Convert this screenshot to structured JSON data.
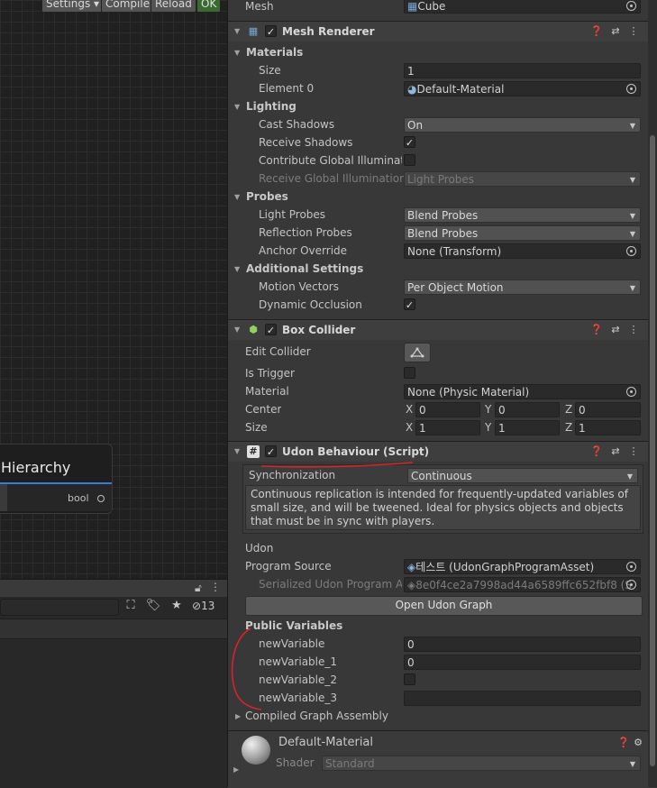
{
  "graph": {
    "top_buttons": {
      "settings": "Settings",
      "compile": "Compile",
      "reload": "Reload",
      "ok": "OK"
    },
    "node": {
      "title": "Hierarchy",
      "output_pin": "bool"
    },
    "bottom_count": "13"
  },
  "inspector": {
    "mesh_filter": {
      "mesh_label": "Mesh",
      "mesh_value": "Cube"
    },
    "mesh_renderer": {
      "title": "Mesh Renderer",
      "materials_label": "Materials",
      "size_label": "Size",
      "size_value": "1",
      "element0_label": "Element 0",
      "element0_value": "Default-Material",
      "lighting_label": "Lighting",
      "cast_shadows_label": "Cast Shadows",
      "cast_shadows_value": "On",
      "receive_shadows_label": "Receive Shadows",
      "receive_shadows_checked": true,
      "contribute_gi_label": "Contribute Global Illuminatio",
      "contribute_gi_checked": false,
      "receive_gi_label": "Receive Global Illumination",
      "receive_gi_value": "Light Probes",
      "probes_label": "Probes",
      "light_probes_label": "Light Probes",
      "light_probes_value": "Blend Probes",
      "reflection_probes_label": "Reflection Probes",
      "reflection_probes_value": "Blend Probes",
      "anchor_override_label": "Anchor Override",
      "anchor_override_value": "None (Transform)",
      "additional_label": "Additional Settings",
      "motion_vectors_label": "Motion Vectors",
      "motion_vectors_value": "Per Object Motion",
      "dynamic_occlusion_label": "Dynamic Occlusion",
      "dynamic_occlusion_checked": true
    },
    "box_collider": {
      "title": "Box Collider",
      "edit_collider_label": "Edit Collider",
      "is_trigger_label": "Is Trigger",
      "is_trigger_checked": false,
      "material_label": "Material",
      "material_value": "None (Physic Material)",
      "center_label": "Center",
      "center": {
        "x": "0",
        "y": "0",
        "z": "0"
      },
      "size_label": "Size",
      "size": {
        "x": "1",
        "y": "1",
        "z": "1"
      },
      "axis": {
        "x": "X",
        "y": "Y",
        "z": "Z"
      }
    },
    "udon": {
      "title": "Udon Behaviour (Script)",
      "sync_label": "Synchronization",
      "sync_value": "Continuous",
      "help_text": "Continuous replication is intended for frequently-updated variables of small size, and will be tweened. Ideal for physics objects and objects that must be in sync with players.",
      "udon_label": "Udon",
      "program_source_label": "Program Source",
      "program_source_value": "테스트 (UdonGraphProgramAsset)",
      "serialized_label": "Serialized Udon Program Ass",
      "serialized_value": "8e0f4ce2a7998ad44a6589ffc652fbf8 (S",
      "open_graph_button": "Open Udon Graph",
      "public_variables_label": "Public Variables",
      "variables": [
        {
          "name": "newVariable",
          "value": "0"
        },
        {
          "name": "newVariable_1",
          "value": "0"
        },
        {
          "name": "newVariable_2",
          "value": ""
        },
        {
          "name": "newVariable_3",
          "value": ""
        }
      ],
      "compiled_label": "Compiled Graph Assembly"
    },
    "material": {
      "name": "Default-Material",
      "shader_label": "Shader",
      "shader_value": "Standard"
    }
  },
  "colors": {
    "annotation_red": "#d8232a",
    "node_accent": "#3b7bd6",
    "ok_green": "#3a6a2f"
  }
}
